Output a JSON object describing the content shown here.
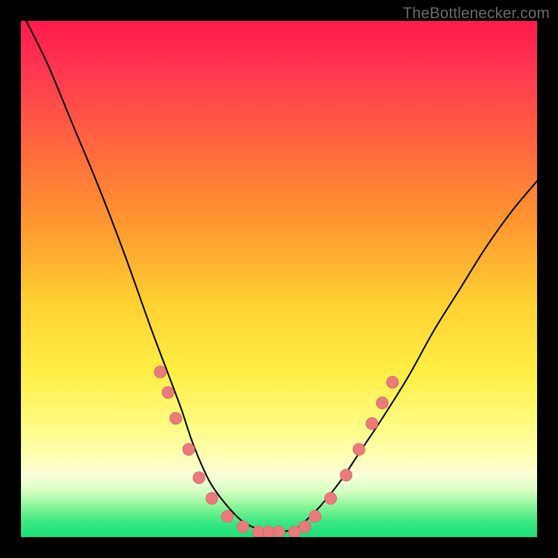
{
  "watermark": "TheBottlenecker.com",
  "chart_data": {
    "type": "line",
    "title": "",
    "xlabel": "",
    "ylabel": "",
    "xlim": [
      0,
      100
    ],
    "ylim": [
      0,
      100
    ],
    "series": [
      {
        "name": "curve",
        "x": [
          0,
          5,
          10,
          15,
          20,
          25,
          28,
          31,
          33,
          35,
          37,
          40,
          43,
          46,
          48,
          50,
          53,
          55,
          58,
          62,
          66,
          70,
          75,
          80,
          85,
          90,
          95,
          100
        ],
        "y": [
          102,
          92,
          80,
          68,
          55,
          41,
          33,
          25,
          19,
          14,
          10,
          6,
          3,
          1.5,
          1,
          1,
          1.5,
          3,
          6,
          11,
          17,
          23,
          31,
          40,
          48,
          56,
          63,
          69
        ]
      }
    ],
    "markers": [
      {
        "x": 27,
        "y": 32
      },
      {
        "x": 28.5,
        "y": 28
      },
      {
        "x": 30,
        "y": 23
      },
      {
        "x": 32.5,
        "y": 17
      },
      {
        "x": 34.5,
        "y": 11.5
      },
      {
        "x": 37,
        "y": 7.5
      },
      {
        "x": 40,
        "y": 4
      },
      {
        "x": 43,
        "y": 2
      },
      {
        "x": 46,
        "y": 1
      },
      {
        "x": 48,
        "y": 1
      },
      {
        "x": 50,
        "y": 1
      },
      {
        "x": 53,
        "y": 1
      },
      {
        "x": 55,
        "y": 2
      },
      {
        "x": 57,
        "y": 4
      },
      {
        "x": 60,
        "y": 7.5
      },
      {
        "x": 63,
        "y": 12
      },
      {
        "x": 65.5,
        "y": 17
      },
      {
        "x": 68,
        "y": 22
      },
      {
        "x": 70,
        "y": 26
      },
      {
        "x": 72,
        "y": 30
      }
    ],
    "marker_color": "#eb7b7b",
    "line_color": "#000000"
  },
  "colors": {
    "frame": "#000000",
    "marker_fill": "#eb7b7b",
    "marker_stroke": "#d96969",
    "curve": "#000000"
  }
}
